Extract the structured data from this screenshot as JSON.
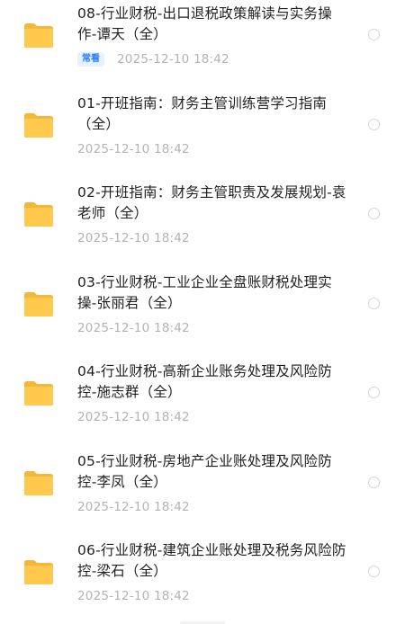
{
  "files": [
    {
      "name": "08-行业财税-出口退税政策解读与实务操作-谭天（全）",
      "badge": "常看",
      "date": "2025-12-10  18:42",
      "icon": "folder-icon"
    },
    {
      "name": "01-开班指南：财务主管训练营学习指南（全）",
      "date": "2025-12-10  18:42",
      "icon": "folder-icon"
    },
    {
      "name": "02-开班指南：财务主管职责及发展规划-袁老师（全）",
      "date": "2025-12-10  18:42",
      "icon": "folder-icon"
    },
    {
      "name": "03-行业财税-工业企业全盘账财税处理实操-张丽君（全）",
      "date": "2025-12-10  18:42",
      "icon": "folder-icon"
    },
    {
      "name": "04-行业财税-高新企业账务处理及风险防控-施志群（全）",
      "date": "2025-12-10  18:42",
      "icon": "folder-icon"
    },
    {
      "name": "05-行业财税-房地产企业账处理及风险防控-李凤（全）",
      "date": "2025-12-10  18:42",
      "icon": "folder-icon"
    },
    {
      "name": "06-行业财税-建筑企业账处理及税务风险防控-梁石（全）",
      "date": "2025-12-10  18:42",
      "icon": "folder-icon"
    }
  ],
  "colors": {
    "folder": "#ffc94d",
    "folder_tab": "#f4b73a",
    "badge_bg": "#e6f1ff",
    "badge_text": "#2a7cf3",
    "date": "#b3b3b3",
    "radio_border": "#d6d6d6"
  }
}
